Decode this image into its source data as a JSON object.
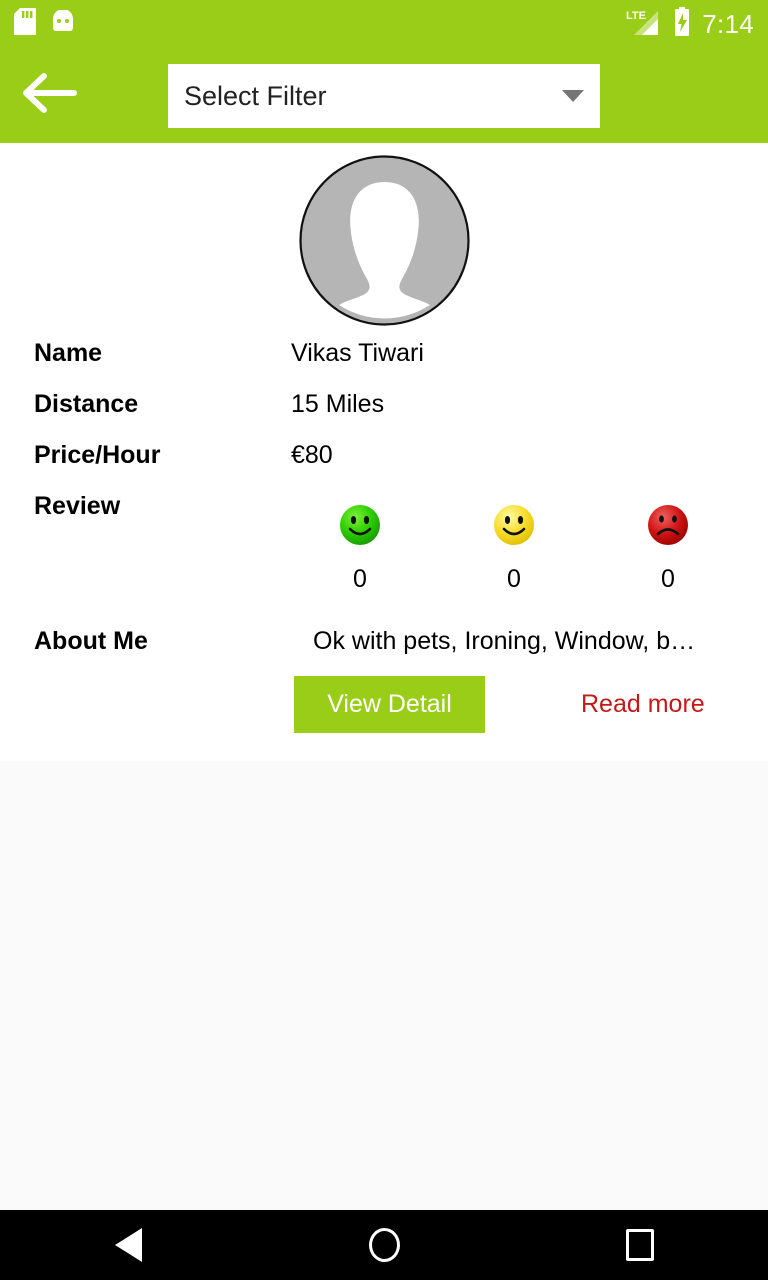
{
  "status_bar": {
    "time": "7:14",
    "icons": [
      "sd-card-icon",
      "android-robot-icon",
      "lte-signal-icon",
      "battery-charging-icon"
    ],
    "network_label": "LTE",
    "background_color": "#9ACD17",
    "foreground_color": "#FFFFFF"
  },
  "app_bar": {
    "back_icon": "arrow-left-icon",
    "filter": {
      "selected_value": "Select Filter",
      "dropdown_icon": "caret-down-icon"
    },
    "background_color": "#9ACD17"
  },
  "profile": {
    "avatar_icon": "person-placeholder-avatar",
    "rows": [
      {
        "label": "Name",
        "value": "Vikas Tiwari"
      },
      {
        "label": "Distance",
        "value": "15 Miles"
      },
      {
        "label": "Price/Hour",
        "value": "€80"
      }
    ],
    "review": {
      "label": "Review",
      "faces": [
        {
          "icon": "smiley-happy-green-icon",
          "color": "#22C000",
          "count": "0"
        },
        {
          "icon": "smiley-neutral-yellow-icon",
          "color": "#F5DD2A",
          "count": "0"
        },
        {
          "icon": "smiley-sad-red-icon",
          "color": "#CC1A1A",
          "count": "0"
        }
      ]
    },
    "about": {
      "label": "About Me",
      "value": "Ok with pets, Ironing, Window, b…"
    },
    "actions": {
      "view_detail_label": "View Detail",
      "view_detail_color": "#9ACD17",
      "read_more_label": "Read more",
      "read_more_color": "#C41919"
    }
  },
  "nav_bar": {
    "back_icon": "nav-back-triangle-icon",
    "home_icon": "nav-home-circle-icon",
    "recents_icon": "nav-recents-square-icon",
    "background_color": "#000000"
  }
}
